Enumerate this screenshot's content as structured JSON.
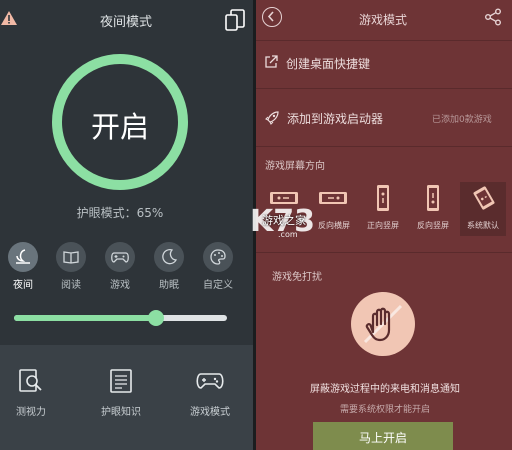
{
  "left_panel": {
    "title": "夜间模式",
    "ring_label": "开启",
    "eye_mode": "护眼模式：65%",
    "brightness_percent": 65,
    "modes": [
      {
        "label": "夜间",
        "icon": "night-icon",
        "active": true
      },
      {
        "label": "阅读",
        "icon": "book-icon",
        "active": false
      },
      {
        "label": "游戏",
        "icon": "gamepad-icon",
        "active": false
      },
      {
        "label": "助眠",
        "icon": "moon-icon",
        "active": false
      },
      {
        "label": "自定义",
        "icon": "palette-icon",
        "active": false
      }
    ],
    "bottom_nav": [
      {
        "label": "测视力",
        "icon": "eye-test-icon"
      },
      {
        "label": "护眼知识",
        "icon": "news-icon"
      },
      {
        "label": "游戏模式",
        "icon": "gamepad-icon"
      }
    ]
  },
  "right_panel": {
    "title": "游戏模式",
    "shortcut_label": "创建桌面快捷键",
    "launcher_label": "添加到游戏启动器",
    "launcher_status": "已添加0款游戏",
    "orientation_section": "游戏屏幕方向",
    "orientations": [
      {
        "label": "",
        "icon": "landscape-icon",
        "active": false
      },
      {
        "label": "反向横屏",
        "icon": "reverse-landscape-icon",
        "active": false
      },
      {
        "label": "正向竖屏",
        "icon": "portrait-icon",
        "active": false
      },
      {
        "label": "反向竖屏",
        "icon": "reverse-portrait-icon",
        "active": false
      },
      {
        "label": "系统默认",
        "icon": "system-default-icon",
        "active": true
      }
    ],
    "dnd_section": "游戏免打扰",
    "block_description": "屏蔽游戏过程中的来电和消息通知",
    "block_sub": "需要系统权限才能开启",
    "enable_button": "马上开启"
  },
  "watermark": {
    "logo": "K73",
    "line1": "游戏之家",
    "line2": ".com"
  },
  "colors": {
    "accent_green": "#8cdfa3",
    "left_bg": "#2e3439",
    "right_bg": "#6e3436",
    "button_olive": "#7e8c4d"
  }
}
